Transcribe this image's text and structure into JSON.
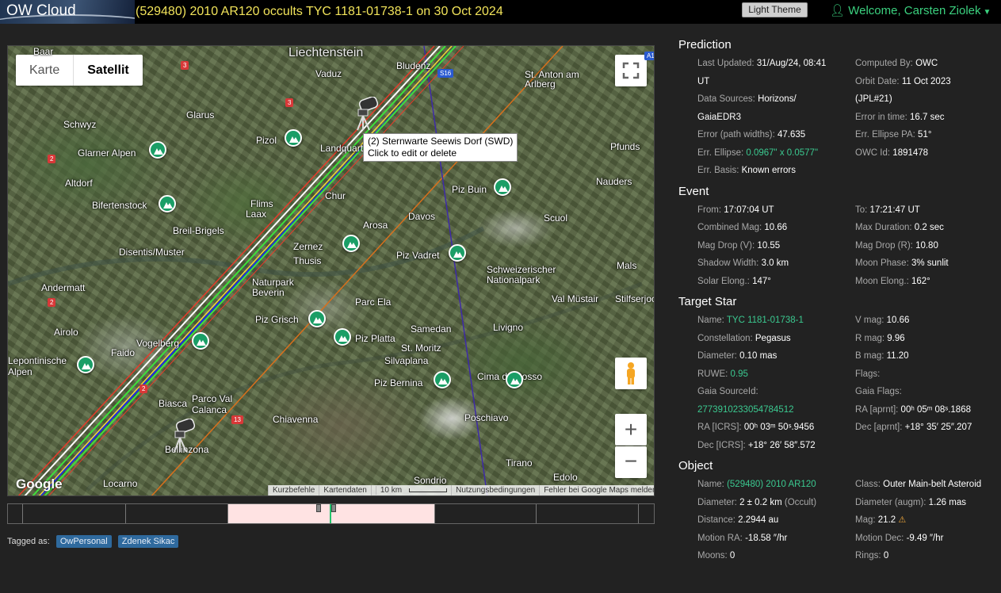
{
  "header": {
    "logo": "OW Cloud",
    "title": "(529480) 2010 AR120 occults TYC 1181-01738-1 on 30 Oct 2024",
    "theme_button": "Light Theme",
    "welcome": "Welcome, Carsten Ziolek"
  },
  "map": {
    "toggle": [
      "Karte",
      "Satellit"
    ],
    "active_toggle": "Satellit",
    "labels": [
      "Liechtenstein",
      "Vaduz",
      "Bludenz",
      "St. Anton am Arlberg",
      "Baar",
      "Schwyz",
      "Glarus",
      "Glarner Alpen",
      "Pizol",
      "Landquart",
      "Pfunds",
      "Altdorf",
      "Bifertenstock",
      "Chur",
      "Piz Buin",
      "Nauders",
      "Flims",
      "Laax",
      "Davos",
      "Scuol",
      "Breil-Brigels",
      "Arosa",
      "Disentis/Muster",
      "Zernez",
      "Thusis",
      "Piz Vadret",
      "Schweizerischer Nationalpark",
      "Mals",
      "Andermatt",
      "Naturpark Beverin",
      "Val Müstair",
      "Stilfserjoch",
      "Parc Ela",
      "Piz Grisch",
      "Piz Platta",
      "Samedan",
      "Livigno",
      "Airolo",
      "Faido",
      "St. Moritz",
      "Silvaplana",
      "Lepontinische Alpen",
      "Vogelberg",
      "Piz Bernina",
      "Cima da Rosso",
      "Biasca",
      "Parco Val Calanca",
      "Chiavenna",
      "Poschiavo",
      "Bellinzona",
      "Tirano",
      "Locarno",
      "Sondrio",
      "Edolo"
    ],
    "road_numbers": [
      "3",
      "3",
      "2",
      "2",
      "2",
      "13",
      "A1",
      "S16"
    ],
    "tooltip_line1": "(2) Sternwarte Seewis Dorf (SWD)",
    "tooltip_line2": "Click to edit or delete",
    "google": "Google",
    "footer": {
      "shortcuts": "Kurzbefehle",
      "mapdata": "Kartendaten",
      "scale": "10 km",
      "terms": "Nutzungsbedingungen",
      "report": "Fehler bei Google Maps melden"
    },
    "icons": [
      "fullscreen-icon",
      "pegman-icon",
      "zoom-in-icon",
      "zoom-out-icon",
      "mountain-pin-icon",
      "telescope-icon"
    ]
  },
  "tags": {
    "label": "Tagged as:",
    "items": [
      "OwPersonal",
      "Zdenek Sikac"
    ]
  },
  "prediction": {
    "title": "Prediction",
    "left": [
      {
        "k": "Last Updated:",
        "v": "31/Aug/24, 08:41"
      },
      {
        "k": "",
        "v": "UT"
      },
      {
        "k": "Data Sources:",
        "v": "Horizons/"
      },
      {
        "k": "",
        "v": "GaiaEDR3"
      },
      {
        "k": "Error (path widths):",
        "v": "47.635"
      },
      {
        "k": "Err. Ellipse:",
        "v": "0.0967\" x 0.0577\"",
        "link": true
      },
      {
        "k": "Err. Basis:",
        "v": "Known errors"
      }
    ],
    "right": [
      {
        "k": "Computed By:",
        "v": "OWC"
      },
      {
        "k": "Orbit Date:",
        "v": "11 Oct 2023"
      },
      {
        "k": "",
        "v": "(JPL#21)"
      },
      {
        "k": "Error in time:",
        "v": "16.7 sec"
      },
      {
        "k": "Err. Ellipse PA:",
        "v": "51°"
      },
      {
        "k": "OWC Id:",
        "v": "1891478"
      }
    ]
  },
  "event": {
    "title": "Event",
    "left": [
      {
        "k": "From:",
        "v": "17:07:04 UT"
      },
      {
        "k": "Combined Mag:",
        "v": "10.66"
      },
      {
        "k": "Mag Drop (V):",
        "v": "10.55"
      },
      {
        "k": "Shadow Width:",
        "v": "3.0 km"
      },
      {
        "k": "Solar Elong.:",
        "v": "147°"
      }
    ],
    "right": [
      {
        "k": "To:",
        "v": "17:21:47 UT"
      },
      {
        "k": "Max Duration:",
        "v": "0.2 sec"
      },
      {
        "k": "Mag Drop (R):",
        "v": "10.80"
      },
      {
        "k": "Moon Phase:",
        "v": "3% sunlit"
      },
      {
        "k": "Moon Elong.:",
        "v": "162°"
      }
    ]
  },
  "target": {
    "title": "Target Star",
    "left": [
      {
        "k": "Name:",
        "v": "TYC 1181-01738-1",
        "link": true
      },
      {
        "k": "Constellation:",
        "v": "Pegasus"
      },
      {
        "k": "Diameter:",
        "v": "0.10 mas"
      },
      {
        "k": "RUWE:",
        "v": "0.95",
        "link": true
      },
      {
        "k": "Gaia SourceId:",
        "v": ""
      },
      {
        "k": "",
        "v": "2773910233054784512",
        "link": true
      },
      {
        "k": "RA [ICRS]:",
        "v": "00ʰ 03ᵐ 50ˢ.9456"
      },
      {
        "k": "Dec [ICRS]:",
        "v": "+18° 26′ 58″.572"
      }
    ],
    "right": [
      {
        "k": "V mag:",
        "v": "10.66"
      },
      {
        "k": "R mag:",
        "v": "9.96"
      },
      {
        "k": "B mag:",
        "v": "11.20"
      },
      {
        "k": "Flags:",
        "v": ""
      },
      {
        "k": "Gaia Flags:",
        "v": ""
      },
      {
        "k": "RA [aprnt]:",
        "v": "00ʰ 05ᵐ 08ˢ.1868"
      },
      {
        "k": "Dec [aprnt]:",
        "v": "+18° 35′ 25″.207"
      }
    ]
  },
  "object": {
    "title": "Object",
    "left": [
      {
        "k": "Name:",
        "v": "(529480) 2010 AR120",
        "link": true
      },
      {
        "k": "Diameter:",
        "v": "2 ± 0.2 km",
        "note": "(Occult)"
      },
      {
        "k": "Distance:",
        "v": "2.2944 au"
      },
      {
        "k": "Motion RA:",
        "v": "-18.58 ″/hr"
      },
      {
        "k": "Moons:",
        "v": "0"
      }
    ],
    "right": [
      {
        "k": "Class:",
        "v": "Outer Main-belt Asteroid"
      },
      {
        "k": "Diameter (augm):",
        "v": "1.26 mas"
      },
      {
        "k": "Mag:",
        "v": "21.2",
        "warn": true
      },
      {
        "k": "Motion Dec:",
        "v": "-9.49 ″/hr"
      },
      {
        "k": "Rings:",
        "v": "0"
      }
    ]
  }
}
